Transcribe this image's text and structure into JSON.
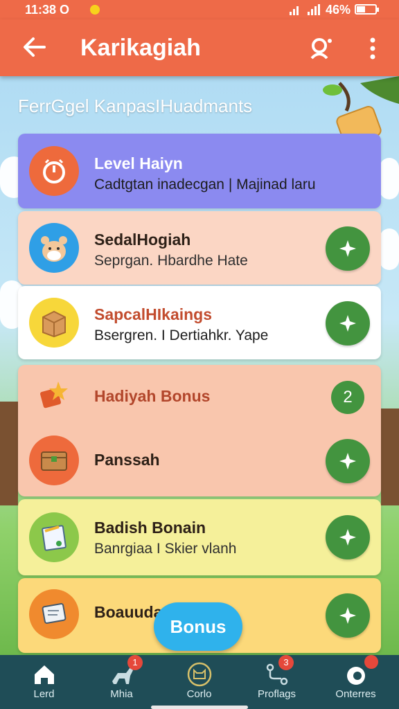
{
  "status_bar": {
    "time": "11:38 O",
    "battery": "46%"
  },
  "app_bar": {
    "title": "Karikagiah"
  },
  "headline": "FerrGgel KanpasIHuadmants",
  "cards": [
    {
      "title": "Level Haiyn",
      "subtitle": "Cadtgtan inadecgan | Majinad laru"
    },
    {
      "title": "SedalHogiah",
      "subtitle": "Seprgan. Hbardhe Hate"
    },
    {
      "title": "SapcalHIkaings",
      "subtitle": "Bsergren. I Dertiahkr. Yape"
    },
    {
      "title": "Hadiyah Bonus",
      "badge": "2"
    },
    {
      "title": "Panssah"
    },
    {
      "title": "Badish Bonain",
      "subtitle": "Banrgiaa I Skier vlanh"
    },
    {
      "title": "Boauudar"
    }
  ],
  "floating_button": {
    "label": "Bonus"
  },
  "bottom_nav": [
    {
      "label": "Lerd",
      "icon": "home-icon"
    },
    {
      "label": "Mhia",
      "icon": "pet-icon",
      "badge": "1"
    },
    {
      "label": "Corlo",
      "icon": "cat-face-icon"
    },
    {
      "label": "Proflags",
      "icon": "route-icon",
      "badge": "3"
    },
    {
      "label": "Onterres",
      "icon": "ring-icon"
    }
  ],
  "colors": {
    "app_bar": "#ee6a48",
    "action_green": "#43943f",
    "nav_bg": "#1f4d57",
    "bonus_blue": "#2fb2ec"
  }
}
